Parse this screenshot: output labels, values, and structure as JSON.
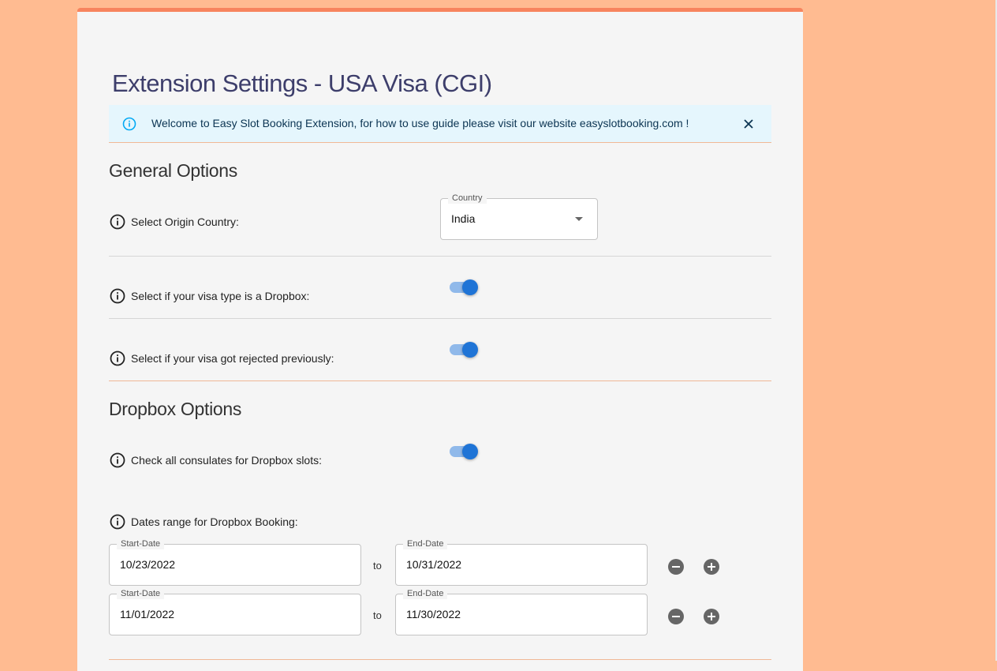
{
  "page": {
    "title": "Extension Settings - USA Visa (CGI)"
  },
  "alert": {
    "message": "Welcome to Easy Slot Booking Extension, for how to use guide please visit our website easyslotbooking.com !",
    "icon": "info-icon",
    "close_icon": "close-icon"
  },
  "general": {
    "heading": "General Options",
    "origin_country": {
      "label": "Select Origin Country:",
      "field_label": "Country",
      "value": "India"
    },
    "dropbox_toggle": {
      "label": "Select if your visa type is a Dropbox:",
      "checked": true
    },
    "rejected_toggle": {
      "label": "Select if your visa got rejected previously:",
      "checked": true
    }
  },
  "dropbox": {
    "heading": "Dropbox Options",
    "all_consulates": {
      "label": "Check all consulates for Dropbox slots:",
      "checked": true
    },
    "date_range_label": "Dates range for Dropbox Booking:",
    "ranges": [
      {
        "start_label": "Start-Date",
        "start": "10/23/2022",
        "separator": "to",
        "end_label": "End-Date",
        "end": "10/31/2022"
      },
      {
        "start_label": "Start-Date",
        "start": "11/01/2022",
        "separator": "to",
        "end_label": "End-Date",
        "end": "11/30/2022"
      }
    ]
  },
  "colors": {
    "accent": "#1f74d6",
    "background": "#ffbb91",
    "card_top": "#f7845e",
    "alert_bg": "#e5f6fd"
  }
}
